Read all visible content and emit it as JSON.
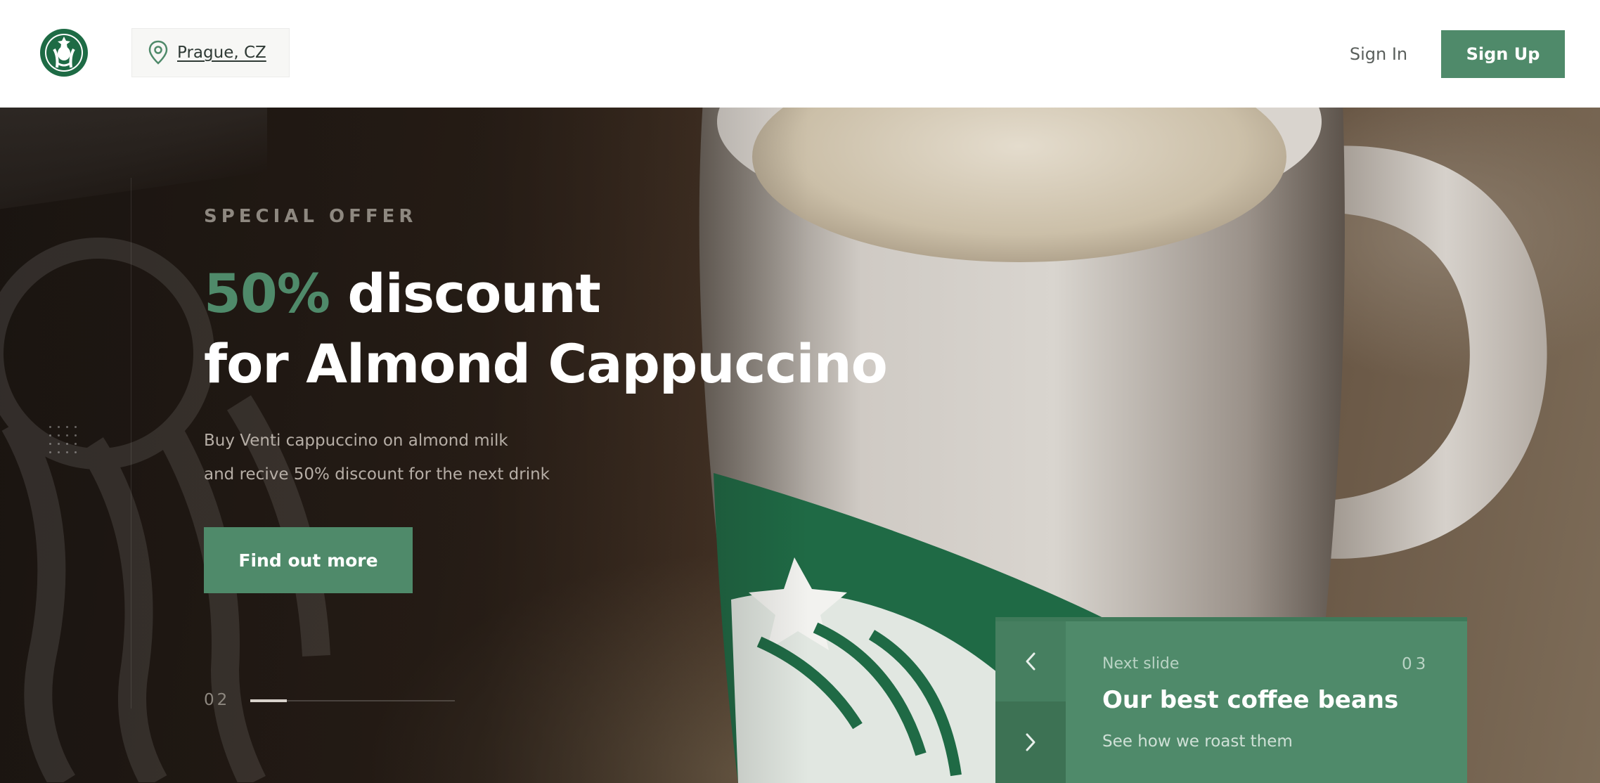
{
  "header": {
    "logo_icon": "starbucks-siren-logo",
    "location": {
      "icon": "map-pin-icon",
      "city": "Prague, CZ"
    },
    "sign_in_label": "Sign In",
    "sign_up_label": "Sign Up"
  },
  "hero": {
    "eyebrow": "SPECIAL OFFER",
    "headline_accent": "50%",
    "headline_rest_line1": " discount",
    "headline_line2": "for Almond Cappuccino",
    "description_line1": "Buy Venti cappuccino on almond milk",
    "description_line2": "and recive 50% discount for the next drink",
    "cta_label": "Find out more",
    "current_slide": "02",
    "slide_progress": 0.18
  },
  "next_slide": {
    "label": "Next slide",
    "index": "03",
    "title": "Our best coffee beans",
    "subtitle": "See how we roast them",
    "prev_icon": "chevron-left-icon",
    "next_icon": "chevron-right-icon"
  },
  "colors": {
    "brand_green": "#4f8a6a",
    "dark_green": "#3d7254",
    "hero_text": "#ffffff"
  }
}
